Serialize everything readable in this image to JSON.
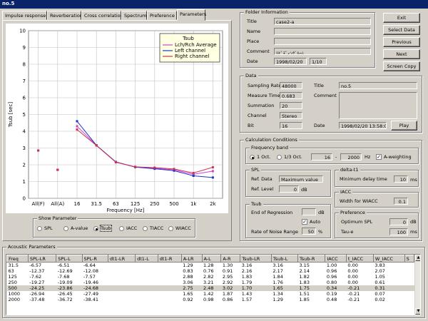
{
  "window": {
    "title": "no.5"
  },
  "tabs": [
    "Impulse response",
    "Reverberation",
    "Cross correlation",
    "Spectrum",
    "Preference",
    "Parameters"
  ],
  "chart_data": {
    "type": "line",
    "ylabel": "Tsub [sec]",
    "xlabel": "Frequency [Hz]",
    "ylim": [
      0,
      10
    ],
    "yticks": [
      "0",
      "1",
      "2",
      "3",
      "4",
      "5",
      "6",
      "7",
      "8",
      "9",
      "10"
    ],
    "categories": [
      "All(F)",
      "All(A)",
      "16",
      "31.5",
      "63",
      "125",
      "250",
      "500",
      "1k",
      "2k"
    ],
    "legend_title": "Tsub",
    "legend_position": "top-right",
    "grid": true,
    "series": [
      {
        "name": "Lch/Rch Average",
        "color": "#cc44cc",
        "values": [
          2.85,
          1.7,
          4.3,
          3.16,
          2.17,
          1.86,
          1.79,
          1.7,
          1.43,
          1.62
        ]
      },
      {
        "name": "Left channel",
        "color": "#2233cc",
        "values": [
          2.85,
          1.7,
          4.6,
          3.16,
          2.17,
          1.86,
          1.76,
          1.65,
          1.34,
          1.24
        ]
      },
      {
        "name": "Right channel",
        "color": "#cc3355",
        "values": [
          2.85,
          1.7,
          4.1,
          3.15,
          2.15,
          1.88,
          1.83,
          1.75,
          1.51,
          1.85
        ]
      }
    ]
  },
  "show_parameter": {
    "title": "Show Parameter",
    "options": [
      "SPL",
      "A-value",
      "Tsub",
      "IACC",
      "TIACC",
      "WIACC"
    ],
    "selected": "Tsub"
  },
  "folder": {
    "title": "Folder Information",
    "labels": {
      "title": "Title",
      "name": "Name",
      "place": "Place",
      "comment": "Comment",
      "date": "Date"
    },
    "title_value": "case2-a",
    "name_value": "",
    "place_value": "",
    "comment_value": "ﾘﾋﾞﾃﾞｨﾝｸﾞﾙｰﾑ",
    "date_value": "1998/02/20",
    "page_value": "1/10"
  },
  "buttons": {
    "exit": "Exit",
    "select_data": "Select Data",
    "previous": "Previous",
    "next": "Next",
    "screen_copy": "Screen Copy",
    "play": "Play"
  },
  "data": {
    "title": "Data",
    "labels": {
      "sampling_rate": "Sampling Rate",
      "measure_time": "Measure Time",
      "summation": "Summation",
      "channel": "Channel",
      "bit": "Bit",
      "title": "Title",
      "comment": "Comment",
      "date": "Date"
    },
    "sampling_rate": "48000",
    "measure_time": "0.683",
    "summation": "20",
    "channel": "Stereo",
    "bit": "16",
    "title_value": "no.5",
    "comment_value": "",
    "date_value": "1998/02/20 13:58:08"
  },
  "calc": {
    "title": "Calculation Conditions",
    "freq_band": {
      "title": "Frequency band",
      "opt1": "1 Oct.",
      "opt2": "1/3 Oct.",
      "from": "16",
      "dash": "-",
      "to": "2000",
      "unit": "Hz",
      "a_weighting": "A-weighting"
    },
    "spl": {
      "title": "SPL",
      "ref_data_label": "Ref. Data",
      "ref_data": "Maximum value",
      "ref_level_label": "Ref. Level",
      "ref_level": "0",
      "unit": "dB"
    },
    "delta_t1": {
      "title": "delta-t1",
      "min_delay_label": "Minimum delay time",
      "min_delay": "10",
      "unit": "ms"
    },
    "iacc": {
      "title": "IACC",
      "width_label": "Width for WIACC",
      "width": "0.1"
    },
    "tsub": {
      "title": "Tsub",
      "end_label": "End of Regression",
      "end_value": "",
      "end_unit": "dB",
      "auto": "Auto",
      "noise_label": "Rate of Noise Range",
      "noise_value": "50",
      "noise_unit": "%"
    },
    "preference": {
      "title": "Preference",
      "opt_spl_label": "Optimum SPL",
      "opt_spl": "0",
      "opt_spl_unit": "dB",
      "tau_e_label": "Tau-e",
      "tau_e": "100",
      "tau_e_unit": "ms"
    }
  },
  "acoustic": {
    "title": "Acoustic Parameters",
    "headers": [
      "Freq",
      "SPL-LR",
      "SPL-L",
      "SPL-R",
      "dt1-LR",
      "dt1-L",
      "dt1-R",
      "A-LR",
      "A-L",
      "A-R",
      "Tsub-LR",
      "Tsub-L",
      "Tsub-R",
      "IACC",
      "t_IACC",
      "W_IACC",
      "S"
    ],
    "rows": [
      [
        "31.5",
        "-6.57",
        "-6.51",
        "-6.64",
        "",
        "",
        "",
        "1.29",
        "1.28",
        "1.30",
        "3.16",
        "3.16",
        "3.15",
        "1.00",
        "0.00",
        "3.83",
        ""
      ],
      [
        "63",
        "-12.37",
        "-12.69",
        "-12.08",
        "",
        "",
        "",
        "0.83",
        "0.76",
        "0.91",
        "2.16",
        "2.17",
        "2.14",
        "0.96",
        "0.00",
        "2.07",
        ""
      ],
      [
        "125",
        "-7.62",
        "-7.68",
        "-7.57",
        "",
        "",
        "",
        "2.88",
        "2.82",
        "2.95",
        "1.83",
        "1.84",
        "1.82",
        "0.96",
        "0.00",
        "1.05",
        ""
      ],
      [
        "250",
        "-19.27",
        "-19.09",
        "-19.46",
        "",
        "",
        "",
        "3.06",
        "3.21",
        "2.92",
        "1.79",
        "1.76",
        "1.83",
        "0.80",
        "0.00",
        "0.61",
        ""
      ],
      [
        "500",
        "-24.25",
        "-23.86",
        "-24.68",
        "",
        "",
        "",
        "2.75",
        "2.48",
        "3.02",
        "1.70",
        "1.65",
        "1.75",
        "0.34",
        "-0.21",
        "0.31",
        ""
      ],
      [
        "1000",
        "-26.94",
        "-26.45",
        "-27.49",
        "",
        "",
        "",
        "1.65",
        "1.42",
        "1.87",
        "1.43",
        "1.34",
        "1.51",
        "0.19",
        "-0.21",
        "0.07",
        ""
      ],
      [
        "2000",
        "-37.48",
        "-36.72",
        "-38.41",
        "",
        "",
        "",
        "0.92",
        "0.98",
        "0.86",
        "1.57",
        "1.29",
        "1.85",
        "0.48",
        "-0.21",
        "0.02",
        ""
      ]
    ]
  }
}
